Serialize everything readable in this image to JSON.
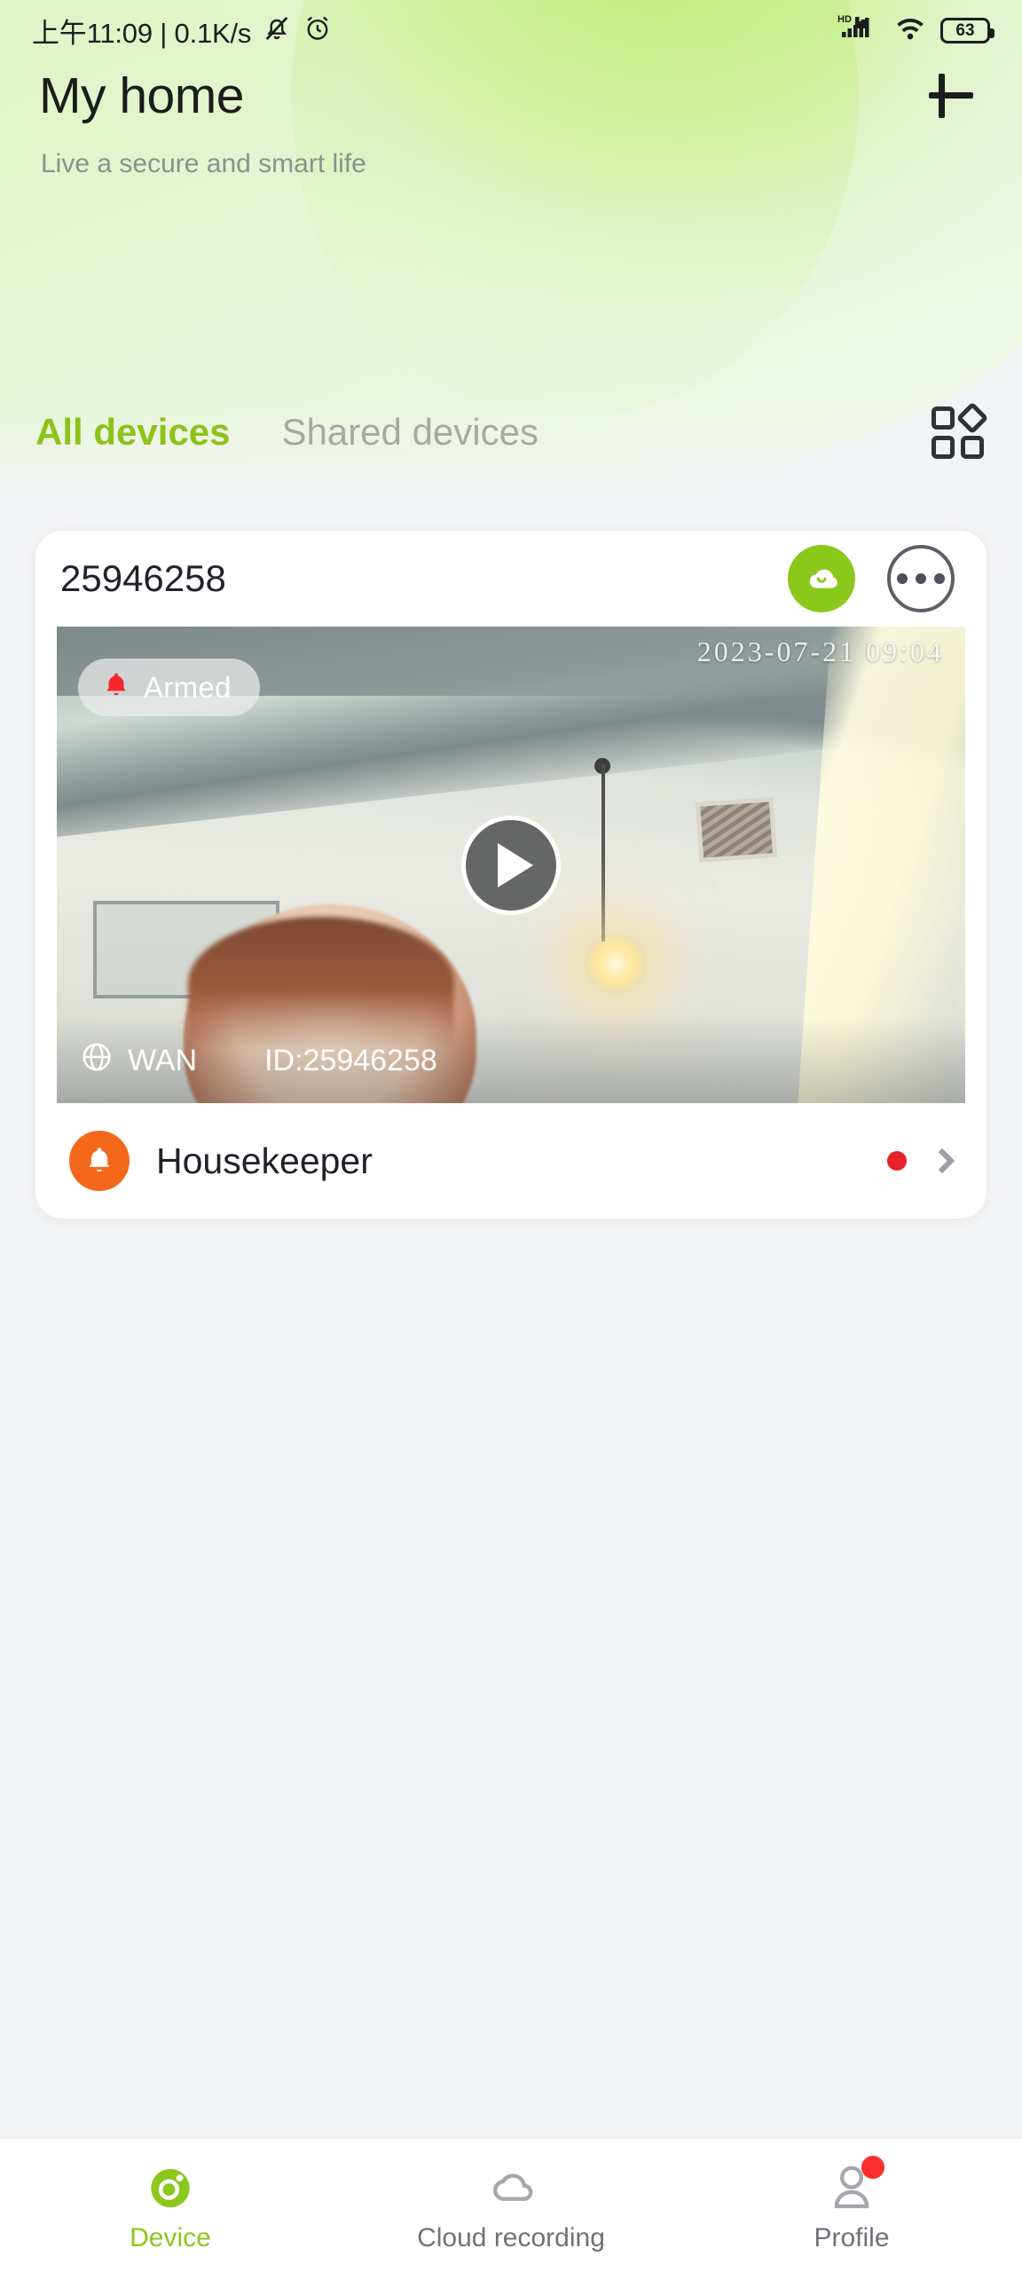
{
  "status_bar": {
    "time_text": "上午11:09 | 0.1K/s",
    "mute_icon": "bell-muted-icon",
    "alarm_icon": "alarm-clock-icon",
    "hd_label": "HD",
    "signal_icon": "cellular-signal-icon",
    "wifi_icon": "wifi-icon",
    "battery_level": "63"
  },
  "header": {
    "title": "My home",
    "subtitle": "Live a secure and smart life",
    "add_icon": "plus-icon"
  },
  "tabs": {
    "all_devices": "All devices",
    "shared_devices": "Shared devices",
    "grid_view_icon": "grid-view-icon"
  },
  "device_card": {
    "device_id": "25946258",
    "cloud_icon": "cloud-icon",
    "more_icon": "more-options-icon",
    "video": {
      "armed_label": "Armed",
      "armed_icon": "bell-icon",
      "timestamp": "2023-07-21    09:04",
      "network_icon": "globe-icon",
      "network_label": "WAN",
      "overlay_id": "ID:25946258",
      "play_icon": "play-icon"
    },
    "housekeeper": {
      "label": "Housekeeper",
      "icon": "bell-notification-icon",
      "has_unread": true,
      "chevron_icon": "chevron-right-icon"
    }
  },
  "bottom_nav": {
    "items": [
      {
        "label": "Device",
        "icon": "camera-icon",
        "active": true,
        "badge": false
      },
      {
        "label": "Cloud recording",
        "icon": "cloud-outline-icon",
        "active": false,
        "badge": false
      },
      {
        "label": "Profile",
        "icon": "person-icon",
        "active": false,
        "badge": true
      }
    ]
  },
  "colors": {
    "accent_green": "#8ac81c",
    "orange": "#f4681c",
    "red_badge": "#e8212b",
    "page_bg": "#f2f3f5"
  }
}
